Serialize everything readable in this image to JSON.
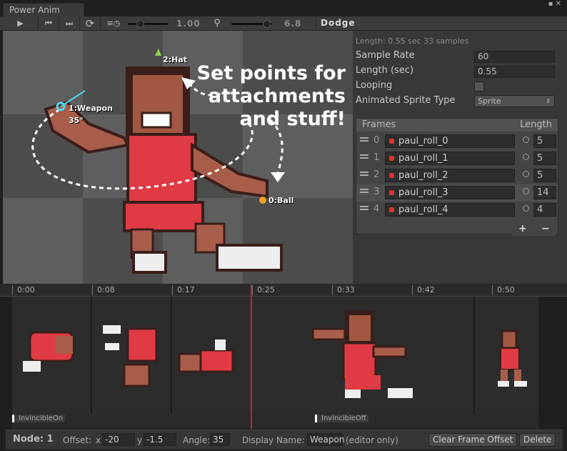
{
  "window": {
    "tab": "Power Anim",
    "controls": "▪ ✕"
  },
  "toolbar": {
    "play": "▶",
    "prev": "⏮",
    "next": "⏭",
    "loop": "⟳",
    "speed_value": "1.00",
    "zoom_value": "6.8",
    "animation_name": "Dodge",
    "speed": 0.1,
    "zoom": 0.95
  },
  "preview": {
    "callout": [
      "Set points for",
      "attachments",
      "and stuff!"
    ],
    "points": [
      {
        "label": "2:Hat",
        "color": "#8fd14f"
      },
      {
        "label": "1:Weapon",
        "color": "#4fd6f0",
        "angle": "35°"
      },
      {
        "label": "0:Ball",
        "color": "#f0a020"
      }
    ]
  },
  "panel": {
    "summary": "Length: 0.55 sec  33 samples",
    "sample_rate_label": "Sample Rate",
    "sample_rate": "60",
    "length_label": "Length (sec)",
    "length": "0.55",
    "looping_label": "Looping",
    "looping": false,
    "sprite_type_label": "Animated Sprite Type",
    "sprite_type": "Sprite",
    "frames_header": "Frames",
    "length_header": "Length",
    "frames": [
      {
        "index": "0",
        "name": "paul_roll_0",
        "length": "5"
      },
      {
        "index": "1",
        "name": "paul_roll_1",
        "length": "5"
      },
      {
        "index": "2",
        "name": "paul_roll_2",
        "length": "5"
      },
      {
        "index": "3",
        "name": "paul_roll_3",
        "length": "14"
      },
      {
        "index": "4",
        "name": "paul_roll_4",
        "length": "4"
      }
    ],
    "add": "+",
    "remove": "−"
  },
  "timeline": {
    "ticks": [
      "0:00",
      "0:08",
      "0:17",
      "0:25",
      "0:33",
      "0:42",
      "0:50"
    ],
    "events": [
      "InvincibleOn",
      "InvincibleOff"
    ]
  },
  "bottom": {
    "node": "Node: 1",
    "offset_label": "Offset:",
    "x_label": "x",
    "x": "-20",
    "y_label": "y",
    "y": "-1.5",
    "angle_label": "Angle:",
    "angle": "35",
    "display_name_label": "Display Name:",
    "display_name": "Weapon",
    "editor_only": "(editor only)",
    "clear_button": "Clear Frame Offset",
    "delete_button": "Delete"
  }
}
